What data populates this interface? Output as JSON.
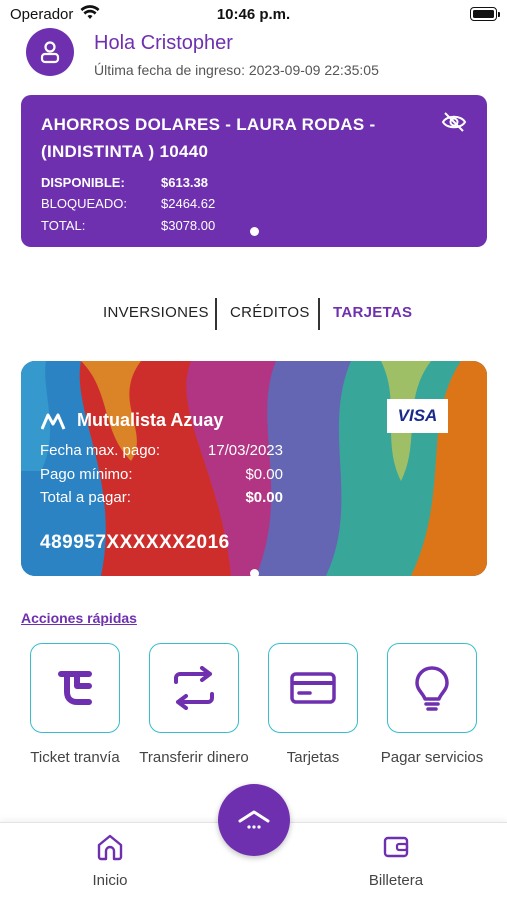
{
  "status_bar": {
    "carrier": "Operador",
    "time": "10:46 p.m."
  },
  "header": {
    "greeting": "Hola Cristopher",
    "last_login": "Última fecha de ingreso: 2023-09-09 22:35:05"
  },
  "account": {
    "name": "AHORROS DOLARES - LAURA RODAS - (INDISTINTA ) 10440",
    "available_label": "DISPONIBLE:",
    "available_value": "$613.38",
    "blocked_label": "BLOQUEADO:",
    "blocked_value": "$2464.62",
    "total_label": "TOTAL:",
    "total_value": "$3078.00"
  },
  "tabs": [
    {
      "label": "INVERSIONES",
      "active": false
    },
    {
      "label": "CRÉDITOS",
      "active": false
    },
    {
      "label": "TARJETAS",
      "active": true
    }
  ],
  "card": {
    "brand": "Mutualista Azuay",
    "network": "VISA",
    "due_date_label": "Fecha max. pago:",
    "due_date_value": "17/03/2023",
    "min_payment_label": "Pago mínimo:",
    "min_payment_value": "$0.00",
    "total_label": "Total a pagar:",
    "total_value": "$0.00",
    "number": "489957XXXXXX2016"
  },
  "quick_actions": {
    "title": "Acciones rápidas",
    "items": [
      {
        "label": "Ticket tranvía",
        "icon": "tram-ticket-icon"
      },
      {
        "label": "Transferir dinero",
        "icon": "transfer-icon"
      },
      {
        "label": "Tarjetas",
        "icon": "credit-card-icon"
      },
      {
        "label": "Pagar servicios",
        "icon": "lightbulb-icon"
      }
    ]
  },
  "bottom_nav": {
    "home_label": "Inicio",
    "wallet_label": "Billetera"
  },
  "colors": {
    "primary": "#6f30b0",
    "accent_border": "#38bcd0"
  }
}
